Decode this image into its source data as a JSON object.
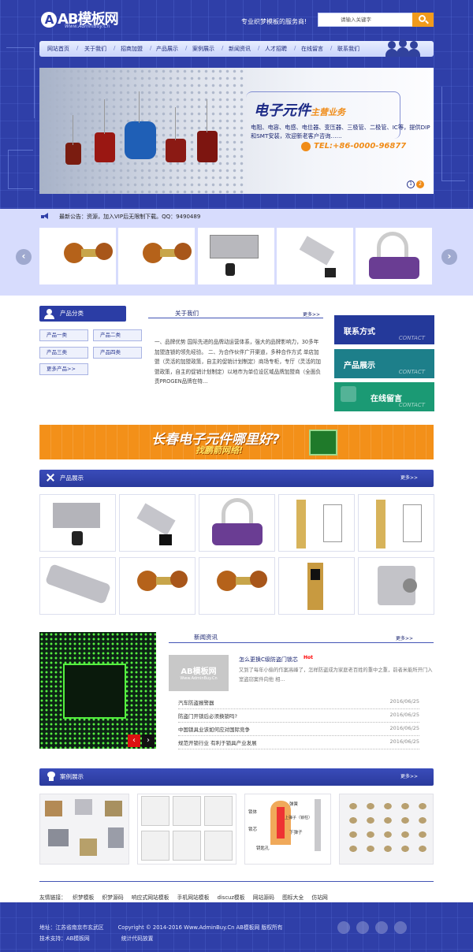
{
  "header": {
    "logo_text": "AB模板网",
    "logo_letter": "A",
    "logo_sub": "Www.AdminBuy.Cn",
    "slogan": "专业织梦模板的服务商!",
    "search_placeholder": "请输入关键字"
  },
  "nav": {
    "items": [
      "网站首页",
      "关于我们",
      "招商加盟",
      "产品展示",
      "案例展示",
      "新闻资讯",
      "人才招聘",
      "在线留言",
      "联系我们"
    ]
  },
  "banner": {
    "title": "电子元件",
    "title_suffix": "主营业务",
    "text": "电阻、电容、电感、电位器、变压器、三极管、二极管、IC等，提供DIP和SMT安装，欢迎新老客户咨询……",
    "tel": "TEL:+86-0000-96877",
    "dots": [
      "1",
      "2"
    ]
  },
  "notice": {
    "text": "最新公告：资源，加入VIP后无限制下载。QQ：9490489"
  },
  "categories": {
    "title": "产品分类",
    "items": [
      "产品一类",
      "产品二类",
      "产品三类",
      "产品四类"
    ],
    "more": "更多产品>>"
  },
  "about": {
    "title": "关于我们",
    "more": "更多>>",
    "text": "一、品牌优势 国际先进的品牌动运营体系，强大的品牌影响力，30多年加盟连锁的领先经验。 二、为合作伙伴广开渠道，多种合作方式 单店加盟（灵活的加盟政策，自主的促销计划制定）商场专柜，专厅（灵活的加盟政策，自主的促销计划制定）以地市为单位设区域品牌加盟商（全面负责PROGEN品牌在特…"
  },
  "side_buttons": [
    {
      "label": "联系方式",
      "en": "CONTACT",
      "color": "#24399a"
    },
    {
      "label": "产品展示",
      "en": "CONTACT",
      "color": "#1d7f8a"
    },
    {
      "label": "在线留言",
      "en": "CONTACT",
      "color": "#1b9a74"
    }
  ],
  "ad": {
    "title": "长春电子元件哪里好?",
    "sub": "找鹏箭网络!"
  },
  "products": {
    "title": "产品展示",
    "more": "更多>>"
  },
  "news": {
    "title": "新闻资讯",
    "more": "更多>>",
    "thumb_text": "AB模板网",
    "thumb_sub": "Www.AdminBuy.Cn",
    "featured_title": "怎么更换C级防盗门锁芯",
    "hot": "Hot",
    "featured_desc": "又到了每年小偷的作案高峰了，怎样防盗成为家庭老百姓的重中之重，前者米能所开门入室盗窃案件向他 相…",
    "list": [
      {
        "title": "汽车防盗报警器",
        "date": "2016/06/25"
      },
      {
        "title": "防盗门开锁后必须换锁吗?",
        "date": "2016/06/25"
      },
      {
        "title": "中国锁具业该如何应对国际竞争",
        "date": "2016/06/25"
      },
      {
        "title": "规范开锁行业 有利于锁具产业发展",
        "date": "2016/06/25"
      }
    ]
  },
  "cases": {
    "title": "案例展示",
    "more": "更多>>",
    "diagram_labels": [
      "锁体",
      "锁芯",
      "弹簧",
      "上弹子（锁柱）",
      "下弹子",
      "钥匙孔"
    ]
  },
  "links": {
    "label": "友情链接：",
    "items": [
      "织梦模板",
      "织梦源码",
      "响应式网站模板",
      "手机网站模板",
      "discuz模板",
      "网站源码",
      "图标大全",
      "仿站网"
    ]
  },
  "footer": {
    "address": "地址：江苏省南京市玄武区",
    "copyright": "Copyright © 2014-2016 Www.AdminBuy.Cn AB模板网 版权所有",
    "support": "技术支持：AB模板网",
    "stats": "统计代码放置"
  }
}
